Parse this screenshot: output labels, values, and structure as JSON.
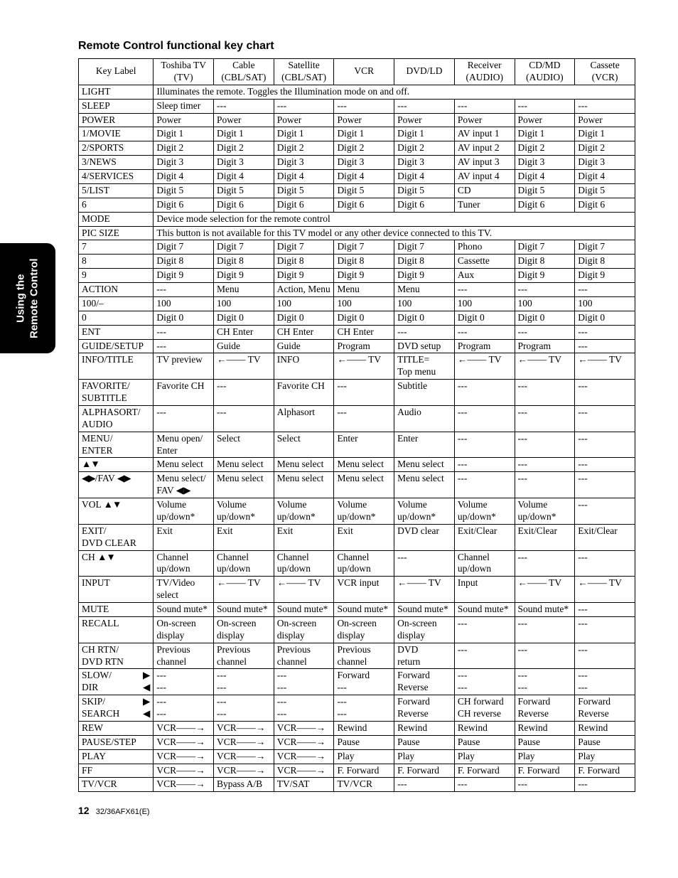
{
  "sideTab": {
    "line1": "Using the",
    "line2": "Remote Control"
  },
  "title": "Remote Control functional key chart",
  "footer": {
    "pageNum": "12",
    "model": "32/36AFX61(E)"
  },
  "columns": [
    {
      "h1": "Key Label",
      "h2": ""
    },
    {
      "h1": "Toshiba TV",
      "h2": "(TV)"
    },
    {
      "h1": "Cable",
      "h2": "(CBL/SAT)"
    },
    {
      "h1": "Satellite",
      "h2": "(CBL/SAT)"
    },
    {
      "h1": "VCR",
      "h2": ""
    },
    {
      "h1": "DVD/LD",
      "h2": ""
    },
    {
      "h1": "Receiver",
      "h2": "(AUDIO)"
    },
    {
      "h1": "CD/MD",
      "h2": "(AUDIO)"
    },
    {
      "h1": "Cassete",
      "h2": "(VCR)"
    }
  ],
  "glyphs": {
    "dash": "---",
    "arrowLeftTV": "←—— TV",
    "arrowVCR": "VCR——→",
    "upDown": "▲▼",
    "leftRight": "◀▶",
    "right": "▶",
    "left": "◀"
  },
  "rows": [
    {
      "key": "LIGHT",
      "span": "Illuminates the remote. Toggles the Illumination mode on and off."
    },
    {
      "key": "SLEEP",
      "c": [
        "Sleep timer",
        "---",
        "---",
        "---",
        "---",
        "---",
        "---",
        "---"
      ]
    },
    {
      "key": "POWER",
      "c": [
        "Power",
        "Power",
        "Power",
        "Power",
        "Power",
        "Power",
        "Power",
        "Power"
      ]
    },
    {
      "key": "1/MOVIE",
      "c": [
        "Digit 1",
        "Digit 1",
        "Digit 1",
        "Digit 1",
        "Digit 1",
        "AV input 1",
        "Digit 1",
        "Digit 1"
      ]
    },
    {
      "key": "2/SPORTS",
      "c": [
        "Digit 2",
        "Digit 2",
        "Digit 2",
        "Digit 2",
        "Digit 2",
        "AV input 2",
        "Digit 2",
        "Digit 2"
      ]
    },
    {
      "key": "3/NEWS",
      "c": [
        "Digit 3",
        "Digit 3",
        "Digit 3",
        "Digit 3",
        "Digit 3",
        "AV input 3",
        "Digit 3",
        "Digit 3"
      ]
    },
    {
      "key": "4/SERVICES",
      "c": [
        "Digit 4",
        "Digit 4",
        "Digit 4",
        "Digit 4",
        "Digit 4",
        "AV input 4",
        "Digit 4",
        "Digit 4"
      ]
    },
    {
      "key": "5/LIST",
      "c": [
        "Digit 5",
        "Digit 5",
        "Digit 5",
        "Digit 5",
        "Digit 5",
        "CD",
        "Digit 5",
        "Digit 5"
      ]
    },
    {
      "key": "6",
      "c": [
        "Digit 6",
        "Digit 6",
        "Digit 6",
        "Digit 6",
        "Digit 6",
        "Tuner",
        "Digit 6",
        "Digit 6"
      ]
    },
    {
      "key": "MODE",
      "span": "Device mode selection for the remote control"
    },
    {
      "key": "PIC SIZE",
      "span": "This button is not available for this TV model or any other device connected to this TV."
    },
    {
      "key": "7",
      "c": [
        "Digit 7",
        "Digit 7",
        "Digit 7",
        "Digit 7",
        "Digit 7",
        "Phono",
        "Digit 7",
        "Digit 7"
      ]
    },
    {
      "key": "8",
      "c": [
        "Digit 8",
        "Digit 8",
        "Digit 8",
        "Digit 8",
        "Digit 8",
        "Cassette",
        "Digit 8",
        "Digit 8"
      ]
    },
    {
      "key": "9",
      "c": [
        "Digit 9",
        "Digit 9",
        "Digit 9",
        "Digit 9",
        "Digit 9",
        "Aux",
        "Digit 9",
        "Digit 9"
      ]
    },
    {
      "key": "ACTION",
      "c": [
        "---",
        "Menu",
        "Action, Menu",
        "Menu",
        "Menu",
        "---",
        "---",
        "---"
      ]
    },
    {
      "key": "100/–",
      "c": [
        "100",
        "100",
        "100",
        "100",
        "100",
        "100",
        "100",
        "100"
      ]
    },
    {
      "key": "0",
      "c": [
        "Digit 0",
        "Digit 0",
        "Digit 0",
        "Digit 0",
        "Digit 0",
        "Digit 0",
        "Digit 0",
        "Digit 0"
      ]
    },
    {
      "key": "ENT",
      "c": [
        "---",
        "CH Enter",
        "CH Enter",
        "CH Enter",
        "---",
        "---",
        "---",
        "---"
      ]
    },
    {
      "key": "GUIDE/SETUP",
      "c": [
        "---",
        "Guide",
        "Guide",
        "Program",
        "DVD setup",
        "Program",
        "Program",
        "---"
      ]
    },
    {
      "key": "INFO/TITLE",
      "c": [
        "TV preview",
        "←—— TV",
        "INFO",
        "←—— TV",
        "TITLE=\nTop menu",
        "←—— TV",
        "←—— TV",
        "←—— TV"
      ]
    },
    {
      "key": "FAVORITE/\nSUBTITLE",
      "c": [
        "Favorite CH",
        "---",
        "Favorite CH",
        "---",
        "Subtitle",
        "---",
        "---",
        "---"
      ]
    },
    {
      "key": "ALPHASORT/\nAUDIO",
      "c": [
        "---",
        "---",
        "Alphasort",
        "---",
        "Audio",
        "---",
        "---",
        "---"
      ]
    },
    {
      "key": "MENU/\nENTER",
      "c": [
        "Menu open/\nEnter",
        "Select",
        "Select",
        "Enter",
        "Enter",
        "---",
        "---",
        "---"
      ]
    },
    {
      "keyGlyph": "upDown",
      "c": [
        "Menu select",
        "Menu select",
        "Menu select",
        "Menu select",
        "Menu select",
        "---",
        "---",
        "---"
      ]
    },
    {
      "keyComposite": {
        "prefix": "",
        "glyph1": "leftRight",
        "mid": "/FAV ",
        "glyph2": "leftRight"
      },
      "c": [
        "Menu select/\nFAV ◀▶",
        "Menu select",
        "Menu select",
        "Menu select",
        "Menu select",
        "---",
        "---",
        "---"
      ]
    },
    {
      "keyComposite": {
        "prefix": "VOL ",
        "glyph1": "upDown"
      },
      "c": [
        "Volume\nup/down*",
        "Volume\nup/down*",
        "Volume\nup/down*",
        "Volume\nup/down*",
        "Volume\nup/down*",
        "Volume\nup/down*",
        "Volume\nup/down*",
        "---"
      ]
    },
    {
      "key": "EXIT/\nDVD CLEAR",
      "c": [
        "Exit",
        "Exit",
        "Exit",
        "Exit",
        "DVD clear",
        "Exit/Clear",
        "Exit/Clear",
        "Exit/Clear"
      ]
    },
    {
      "keyComposite": {
        "prefix": "CH ",
        "glyph1": "upDown"
      },
      "c": [
        "Channel\nup/down",
        "Channel\nup/down",
        "Channel\nup/down",
        "Channel\nup/down",
        "---",
        "Channel\nup/down",
        "---",
        "---"
      ]
    },
    {
      "key": "INPUT",
      "c": [
        "TV/Video\nselect",
        "←—— TV",
        "←—— TV",
        "VCR input",
        "←—— TV",
        "Input",
        "←—— TV",
        "←—— TV"
      ]
    },
    {
      "key": "MUTE",
      "c": [
        "Sound mute*",
        "Sound mute*",
        "Sound mute*",
        "Sound mute*",
        "Sound mute*",
        "Sound mute*",
        "Sound mute*",
        "---"
      ]
    },
    {
      "key": "RECALL",
      "c": [
        "On-screen\ndisplay",
        "On-screen\ndisplay",
        "On-screen\ndisplay",
        "On-screen\ndisplay",
        "On-screen\ndisplay",
        "---",
        "---",
        "---"
      ]
    },
    {
      "key": "CH RTN/\nDVD RTN",
      "c": [
        "Previous\nchannel",
        "Previous\nchannel",
        "Previous\nchannel",
        "Previous\nchannel",
        "DVD\nreturn",
        "---",
        "---",
        "---"
      ]
    },
    {
      "keyArrowPair": {
        "line1": "SLOW/",
        "g1": "right",
        "line2": "DIR",
        "g2": "left"
      },
      "c": [
        "---\n---",
        "---\n---",
        "---\n---",
        "Forward\n---",
        "Forward\nReverse",
        "---\n---",
        "---\n---",
        "---\n---"
      ]
    },
    {
      "keyArrowPair": {
        "line1": "SKIP/",
        "g1": "right",
        "line2": "SEARCH",
        "g2": "left"
      },
      "c": [
        "---\n---",
        "---\n---",
        "---\n---",
        "---\n---",
        "Forward\nReverse",
        "CH forward\nCH reverse",
        "Forward\nReverse",
        "Forward\nReverse"
      ]
    },
    {
      "key": "REW",
      "c": [
        "VCR——→",
        "VCR——→",
        "VCR——→",
        "Rewind",
        "Rewind",
        "Rewind",
        "Rewind",
        "Rewind"
      ]
    },
    {
      "key": "PAUSE/STEP",
      "c": [
        "VCR——→",
        "VCR——→",
        "VCR——→",
        "Pause",
        "Pause",
        "Pause",
        "Pause",
        "Pause"
      ]
    },
    {
      "key": "PLAY",
      "c": [
        "VCR——→",
        "VCR——→",
        "VCR——→",
        "Play",
        "Play",
        "Play",
        "Play",
        "Play"
      ]
    },
    {
      "key": "FF",
      "c": [
        "VCR——→",
        "VCR——→",
        "VCR——→",
        "F. Forward",
        "F. Forward",
        "F. Forward",
        "F. Forward",
        "F. Forward"
      ]
    },
    {
      "key": "TV/VCR",
      "c": [
        "VCR——→",
        "Bypass A/B",
        "TV/SAT",
        "TV/VCR",
        "---",
        "---",
        "---",
        "---"
      ]
    }
  ]
}
